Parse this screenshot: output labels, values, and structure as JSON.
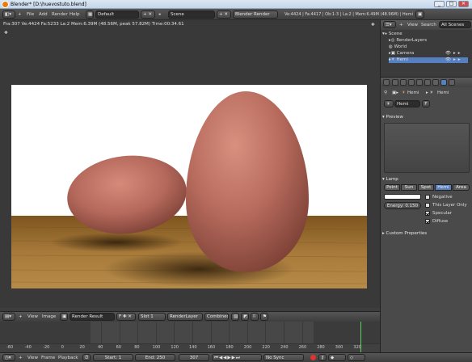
{
  "window": {
    "title": "Blender* [D:\\huevostuto.blend]",
    "controls": [
      "_",
      "□",
      "✕"
    ]
  },
  "info_header": {
    "menus": [
      "File",
      "Add",
      "Render",
      "Help"
    ],
    "layout": "Default",
    "scene": "Scene",
    "engine": "Blender Render",
    "stats": "Ve:4424 | Fa:4417 | Ob:1-3 | La:2 | Mem:6.49M (48.96M) | Hemi"
  },
  "viewport": {
    "render_stats": "Fra:307  Ve:4424 Fa:5233 La:2 Mem:6.39M (48.56M, peak 57.82M) Time:00:34.61"
  },
  "image_editor_header": {
    "menus": [
      "View",
      "Image"
    ],
    "image": "Render Result",
    "slot": "Slot 1",
    "layer": "RenderLayer",
    "pass": "Combined"
  },
  "timeline": {
    "ticks": [
      "-60",
      "-40",
      "-20",
      "0",
      "20",
      "40",
      "60",
      "80",
      "100",
      "120",
      "140",
      "160",
      "180",
      "200",
      "220",
      "240",
      "260",
      "280",
      "300",
      "320"
    ],
    "current_frame_marker": 307
  },
  "timeline_header": {
    "menus": [
      "View",
      "Frame",
      "Playback"
    ],
    "start": "Start: 1",
    "end": "End: 250",
    "current": "307",
    "sync": "No Sync"
  },
  "outliner": {
    "header_menus": [
      "View",
      "Search"
    ],
    "display_mode": "All Scenes",
    "items": [
      {
        "label": "Scene",
        "indent": 0
      },
      {
        "label": "RenderLayers",
        "indent": 1
      },
      {
        "label": "World",
        "indent": 1
      },
      {
        "label": "Camera",
        "indent": 1
      },
      {
        "label": "Hemi",
        "indent": 1
      }
    ]
  },
  "properties": {
    "breadcrumb": [
      "Hemi",
      "Hemi"
    ],
    "datablock": "Hemi",
    "datablock_users": "F",
    "preview_label": "Preview",
    "lamp_label": "Lamp",
    "lamp_types": [
      "Point",
      "Sun",
      "Spot",
      "Hemi",
      "Area"
    ],
    "active_lamp_type": "Hemi",
    "energy": "Energy: 0.150",
    "options": [
      {
        "label": "Negative",
        "checked": false
      },
      {
        "label": "This Layer Only",
        "checked": false
      },
      {
        "label": "Specular",
        "checked": true
      },
      {
        "label": "Diffuse",
        "checked": true
      }
    ],
    "custom_properties_label": "Custom Properties"
  },
  "colors": {
    "accent": "#5680c2",
    "egg": "#b5695c",
    "table": "#a77a3a"
  }
}
